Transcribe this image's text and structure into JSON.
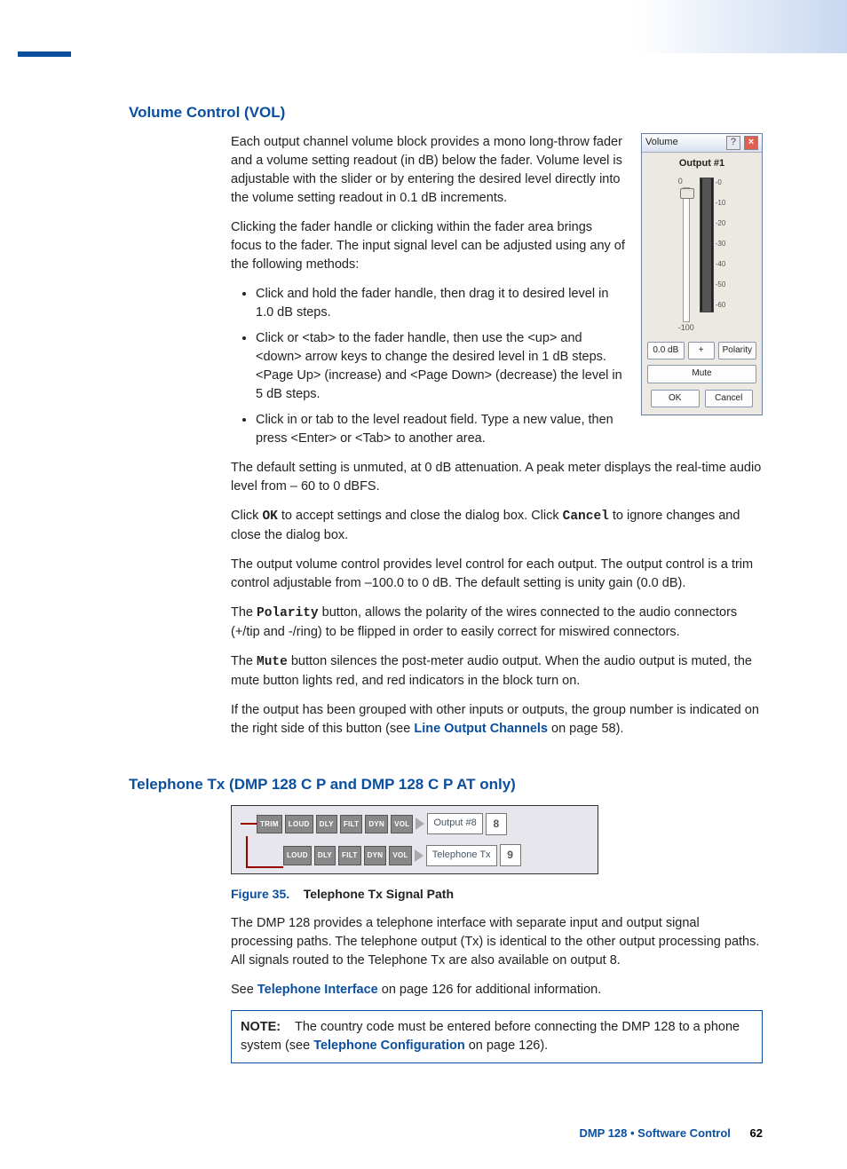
{
  "section1": {
    "title": "Volume Control (VOL)",
    "p1": "Each output channel volume block provides a mono long-throw fader and a volume setting readout (in dB) below the fader. Volume level is adjustable with the slider or by entering the desired level directly into the volume setting readout in 0.1 dB increments.",
    "p2": "Clicking the fader handle or clicking within the fader area brings focus to the fader. The input signal level can be adjusted using any of the following methods:",
    "bullets": [
      "Click and hold the fader handle, then drag it to desired level in 1.0 dB steps.",
      "Click or <tab> to the fader handle, then use the <up> and <down> arrow keys to change the desired level in 1 dB steps. <Page Up> (increase) and <Page Down> (decrease) the level in 5 dB steps.",
      "Click in or tab to the level readout field. Type a new value, then press <Enter> or <Tab> to another area."
    ],
    "p3": "The default setting is unmuted, at 0 dB attenuation. A peak meter displays the real-time audio level from – 60 to 0 dBFS.",
    "p4a": "Click ",
    "p4_ok": "OK",
    "p4b": " to accept settings and close the dialog box. Click ",
    "p4_cancel": "Cancel",
    "p4c": " to ignore changes and close the dialog box.",
    "p5": "The output volume control provides level control for each output. The output control is a trim control adjustable from –100.0 to 0 dB. The default setting is unity gain (0.0 dB).",
    "p6a": "The ",
    "p6_pol": "Polarity",
    "p6b": " button, allows the polarity of the wires connected to the audio connectors (+/tip and -/ring) to be flipped in order to easily correct for miswired connectors.",
    "p7a": "The ",
    "p7_mute": "Mute",
    "p7b": " button silences the post-meter audio output. When the audio output is muted, the mute button lights red, and red indicators in the block turn on.",
    "p8a": "If the output has been grouped with other inputs or outputs, the group number is indicated on the right side of this button (see ",
    "p8_link": "Line Output Channels",
    "p8b": " on page 58)."
  },
  "vol_dialog": {
    "title": "Volume",
    "output": "Output #1",
    "top": "0",
    "bottom": "-100",
    "ticks": [
      "-0",
      "-10",
      "-20",
      "-30",
      "-40",
      "-50",
      "-60"
    ],
    "db": "0.0 dB",
    "plus": "+",
    "polarity": "Polarity",
    "mute": "Mute",
    "ok": "OK",
    "cancel": "Cancel"
  },
  "section2": {
    "title": "Telephone Tx (DMP 128 C P and DMP 128 C P AT only)",
    "row1": {
      "blocks": [
        "TRIM",
        "LOUD",
        "DLY",
        "FILT",
        "DYN",
        "VOL"
      ],
      "label": "Output #8",
      "num": "8"
    },
    "row2": {
      "blocks": [
        "LOUD",
        "DLY",
        "FILT",
        "DYN",
        "VOL"
      ],
      "label": "Telephone Tx",
      "num": "9"
    },
    "fig_num": "Figure 35.",
    "fig_title": "Telephone Tx Signal Path",
    "p1": "The DMP 128 provides a telephone interface with separate input and output signal processing paths. The telephone output (Tx) is identical to the other output processing paths. All signals routed to the Telephone Tx are also available on output 8.",
    "p2a": "See ",
    "p2_link": "Telephone Interface",
    "p2b": " on page 126 for additional information.",
    "note_label": "NOTE:",
    "note_a": "The country code must be entered before connecting the DMP 128 to a phone system (see ",
    "note_link": "Telephone Configuration",
    "note_b": " on page 126)."
  },
  "footer": {
    "text": "DMP 128 • Software Control",
    "page": "62"
  }
}
